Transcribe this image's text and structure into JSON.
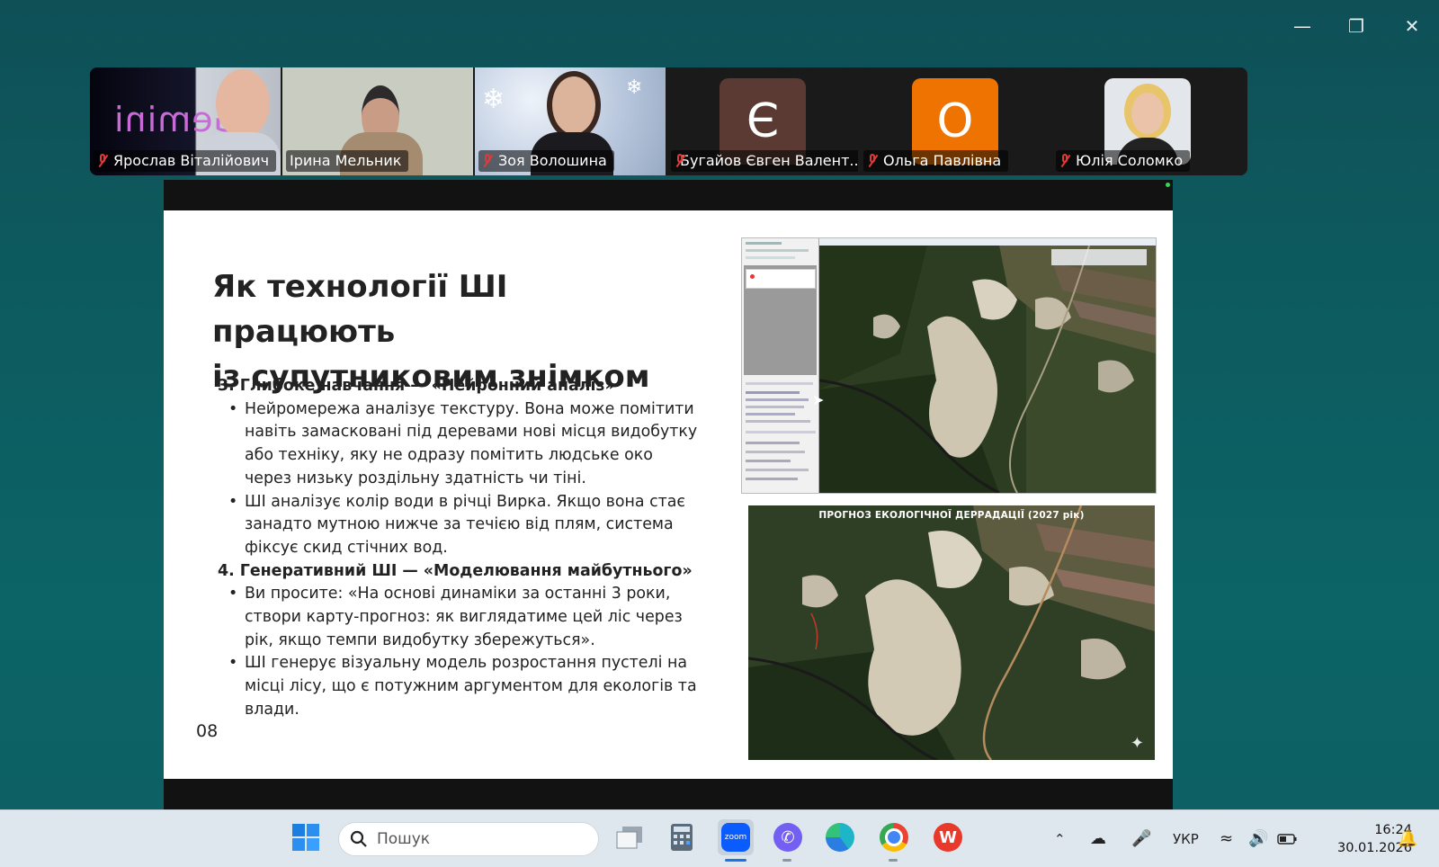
{
  "participants": [
    {
      "name": "Ярослав Віталійович",
      "muted": true,
      "overlay_text": "Gemini"
    },
    {
      "name": "Ірина Мельник",
      "muted": false,
      "active": true
    },
    {
      "name": "Зоя Волошина",
      "muted": true
    },
    {
      "name": "Бугайов Євген Валент...",
      "muted": true,
      "initial": "Є",
      "color": "#5a3a32"
    },
    {
      "name": "Ольга Павлівна",
      "muted": true,
      "initial": "О",
      "color": "#ee7300"
    },
    {
      "name": "Юлія Соломко",
      "muted": true
    }
  ],
  "slide": {
    "title_line1": "Як технології ШІ працюють",
    "title_line2": "із супутниковим знімком",
    "section3_heading": "3. Глибоке навчання — «Нейронний аналіз»",
    "section3_bullets": [
      "Нейромережа аналізує текстуру. Вона може помітити навіть замасковані під деревами нові місця видобутку або техніку, яку не одразу помітить людське око через низьку роздільну здатність чи тіні.",
      "ШІ аналізує колір води в річці Вирка. Якщо вона стає занадто мутною нижче за течією від плям, система фіксує скид стічних вод."
    ],
    "section4_heading": "4. Генеративний ШІ — «Моделювання майбутнього»",
    "section4_bullets": [
      "Ви просите: «На основі динаміки за останні 3 роки, створи карту-прогноз: як виглядатиме цей ліс через рік, якщо темпи видобутку збережуться».",
      "ШІ генерує візуальну модель розростання пустелі на місці лісу, що є потужним аргументом для екологів та влади."
    ],
    "page_number": "08",
    "image2_caption": "ПРОГНОЗ ЕКОЛОГІЧНОЇ ДЕРРАДАЦІЇ (2027 рік)"
  },
  "taskbar": {
    "search_placeholder": "Пошук",
    "language": "УКР",
    "time": "16:24",
    "date": "30.01.2026",
    "zoom_label": "zoom"
  },
  "colors": {
    "background": "#0d5a5e",
    "active_speaker": "#39d353",
    "muted": "#e23a3a"
  }
}
